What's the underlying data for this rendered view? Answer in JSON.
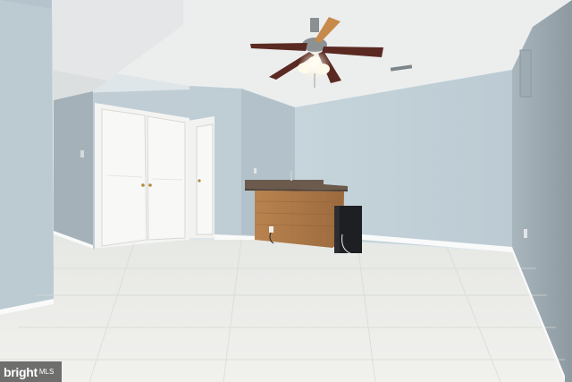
{
  "watermark": {
    "brand": "bright",
    "suffix": "MLS"
  }
}
